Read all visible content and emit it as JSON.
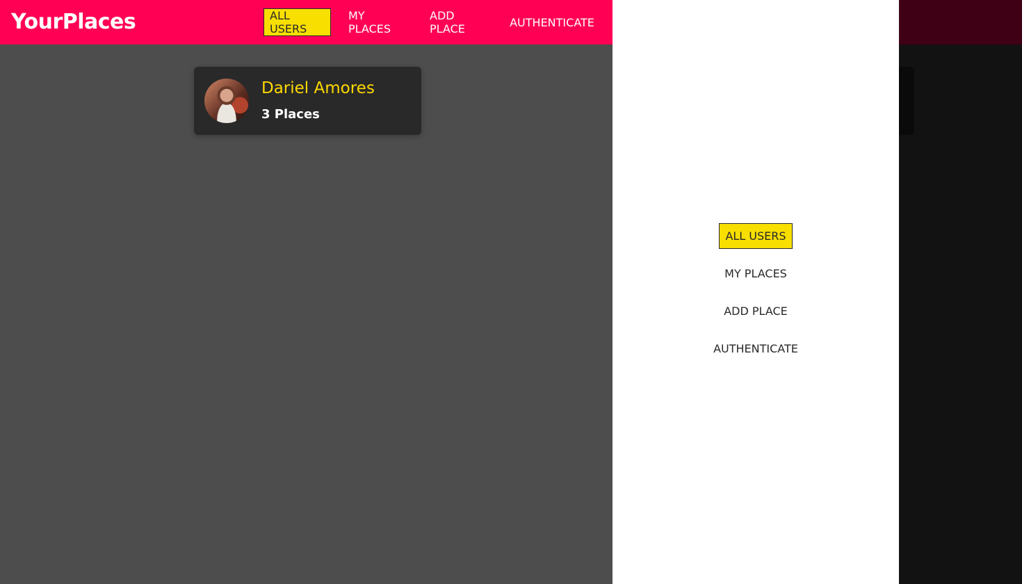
{
  "app": {
    "logo": "YourPlaces"
  },
  "nav": {
    "items": [
      {
        "label": "ALL USERS",
        "active": true
      },
      {
        "label": "MY PLACES",
        "active": false
      },
      {
        "label": "ADD PLACE",
        "active": false
      },
      {
        "label": "AUTHENTICATE",
        "active": false
      }
    ]
  },
  "users": [
    {
      "name": "Dariel Amores",
      "places": "3 Places"
    }
  ],
  "drawer": {
    "items": [
      {
        "label": "ALL USERS",
        "active": true
      },
      {
        "label": "MY PLACES",
        "active": false
      },
      {
        "label": "ADD PLACE",
        "active": false
      },
      {
        "label": "AUTHENTICATE",
        "active": false
      }
    ]
  },
  "colors": {
    "header": "#ff0055",
    "accent": "#f8df00",
    "user_name": "#ffd900",
    "card": "#292929",
    "background": "#4d4d4d",
    "drawer": "#ffffff"
  }
}
